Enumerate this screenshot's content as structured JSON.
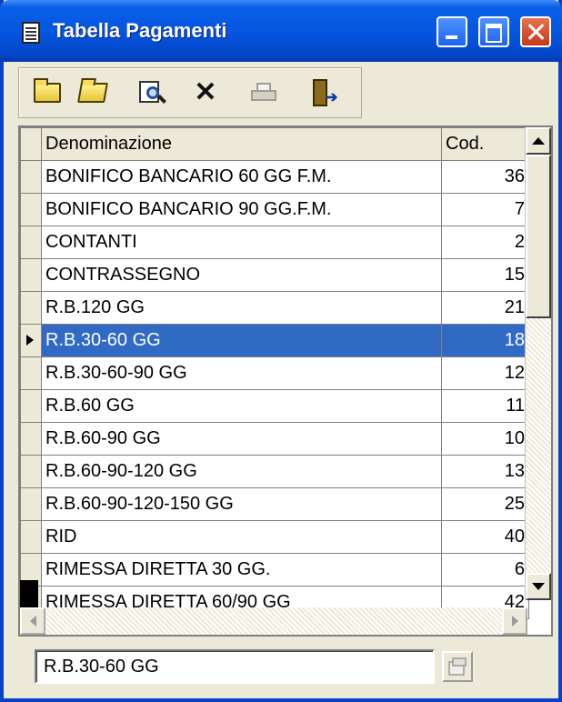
{
  "window": {
    "title": "Tabella Pagamenti",
    "title_icon": "notepad-icon",
    "accent_color": "#0a5fe7"
  },
  "toolbar": {
    "buttons": [
      {
        "icon": "folder-icon",
        "enabled": true
      },
      {
        "icon": "open-folder-icon",
        "enabled": true
      },
      {
        "icon": "search-document-icon",
        "enabled": true
      },
      {
        "icon": "delete-x-icon",
        "enabled": true
      },
      {
        "icon": "printer-icon",
        "enabled": false
      },
      {
        "icon": "exit-door-icon",
        "enabled": true
      }
    ]
  },
  "grid": {
    "headers": {
      "name": "Denominazione",
      "code": "Cod."
    },
    "selected_index": 5,
    "selection_color": "#316ac5",
    "rows": [
      {
        "name": "BONIFICO BANCARIO 60 GG F.M.",
        "code": "36"
      },
      {
        "name": "BONIFICO BANCARIO 90 GG.F.M.",
        "code": "7"
      },
      {
        "name": "CONTANTI",
        "code": "2"
      },
      {
        "name": "CONTRASSEGNO",
        "code": "15"
      },
      {
        "name": "R.B.120 GG",
        "code": "21"
      },
      {
        "name": "R.B.30-60 GG",
        "code": "18"
      },
      {
        "name": "R.B.30-60-90 GG",
        "code": "12"
      },
      {
        "name": "R.B.60 GG",
        "code": "11"
      },
      {
        "name": "R.B.60-90 GG",
        "code": "10"
      },
      {
        "name": "R.B.60-90-120 GG",
        "code": "13"
      },
      {
        "name": "R.B.60-90-120-150 GG",
        "code": "25"
      },
      {
        "name": "RID",
        "code": "40"
      },
      {
        "name": "RIMESSA DIRETTA 30 GG.",
        "code": "6"
      },
      {
        "name": "RIMESSA DIRETTA 60/90 GG",
        "code": "42"
      }
    ]
  },
  "status": {
    "current_value": "R.B.30-60 GG",
    "button_icon": "properties-icon"
  }
}
